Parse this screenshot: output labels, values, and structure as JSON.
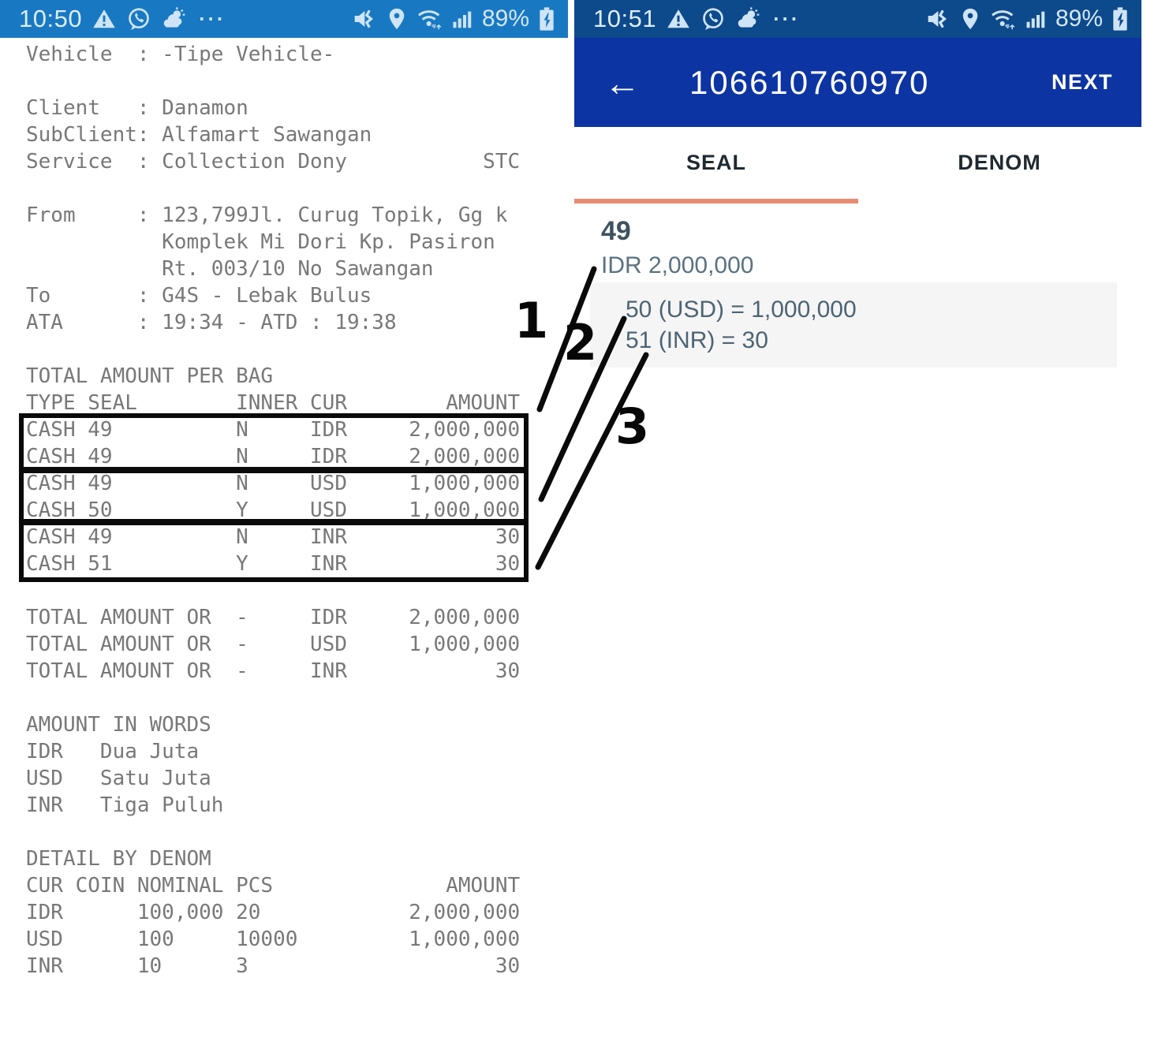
{
  "left_screen": {
    "status_bar": {
      "time": "10:50",
      "battery_percent": "89%"
    },
    "receipt_lines": [
      "Vehicle  : -Tipe Vehicle-",
      "",
      "Client   : Danamon",
      "SubClient: Alfamart Sawangan",
      "Service  : Collection Dony           STC",
      "",
      "From     : 123,799Jl. Curug Topik, Gg k",
      "           Komplek Mi Dori Kp. Pasiron",
      "           Rt. 003/10 No Sawangan",
      "To       : G4S - Lebak Bulus",
      "ATA      : 19:34 - ATD : 19:38",
      "",
      "TOTAL AMOUNT PER BAG",
      "TYPE SEAL        INNER CUR        AMOUNT",
      "CASH 49          N     IDR     2,000,000",
      "CASH 49          N     IDR     2,000,000",
      "CASH 49          N     USD     1,000,000",
      "CASH 50          Y     USD     1,000,000",
      "CASH 49          N     INR            30",
      "CASH 51          Y     INR            30",
      "",
      "TOTAL AMOUNT OR  -     IDR     2,000,000",
      "TOTAL AMOUNT OR  -     USD     1,000,000",
      "TOTAL AMOUNT OR  -     INR            30",
      "",
      "AMOUNT IN WORDS",
      "IDR   Dua Juta",
      "USD   Satu Juta",
      "INR   Tiga Puluh",
      "",
      "DETAIL BY DENOM",
      "CUR COIN NOMINAL PCS              AMOUNT",
      "IDR      100,000 20            2,000,000",
      "USD      100     10000         1,000,000",
      "INR      10      3                    30"
    ]
  },
  "right_screen": {
    "status_bar": {
      "time": "10:51",
      "battery_percent": "89%"
    },
    "header": {
      "title": "106610760970",
      "next_label": "NEXT"
    },
    "tabs": [
      {
        "label": "SEAL",
        "active": true
      },
      {
        "label": "DENOM",
        "active": false
      }
    ],
    "seal_detail": {
      "seal_number": "49",
      "amount": "IDR 2,000,000",
      "inner_seals": [
        "50 (USD) = 1,000,000",
        "51 (INR) = 30"
      ]
    }
  },
  "annotations": {
    "labels": [
      "1",
      "2",
      "3"
    ]
  },
  "colors": {
    "left_status_bar": "#1879c2",
    "right_status_bar": "#0d4a8c",
    "app_header": "#0c34a2",
    "tab_indicator": "#e98a72",
    "receipt_text": "#787878",
    "seal_text": "#3e525e",
    "inner_box_bg": "#f5f5f6",
    "annotation": "#000000"
  }
}
